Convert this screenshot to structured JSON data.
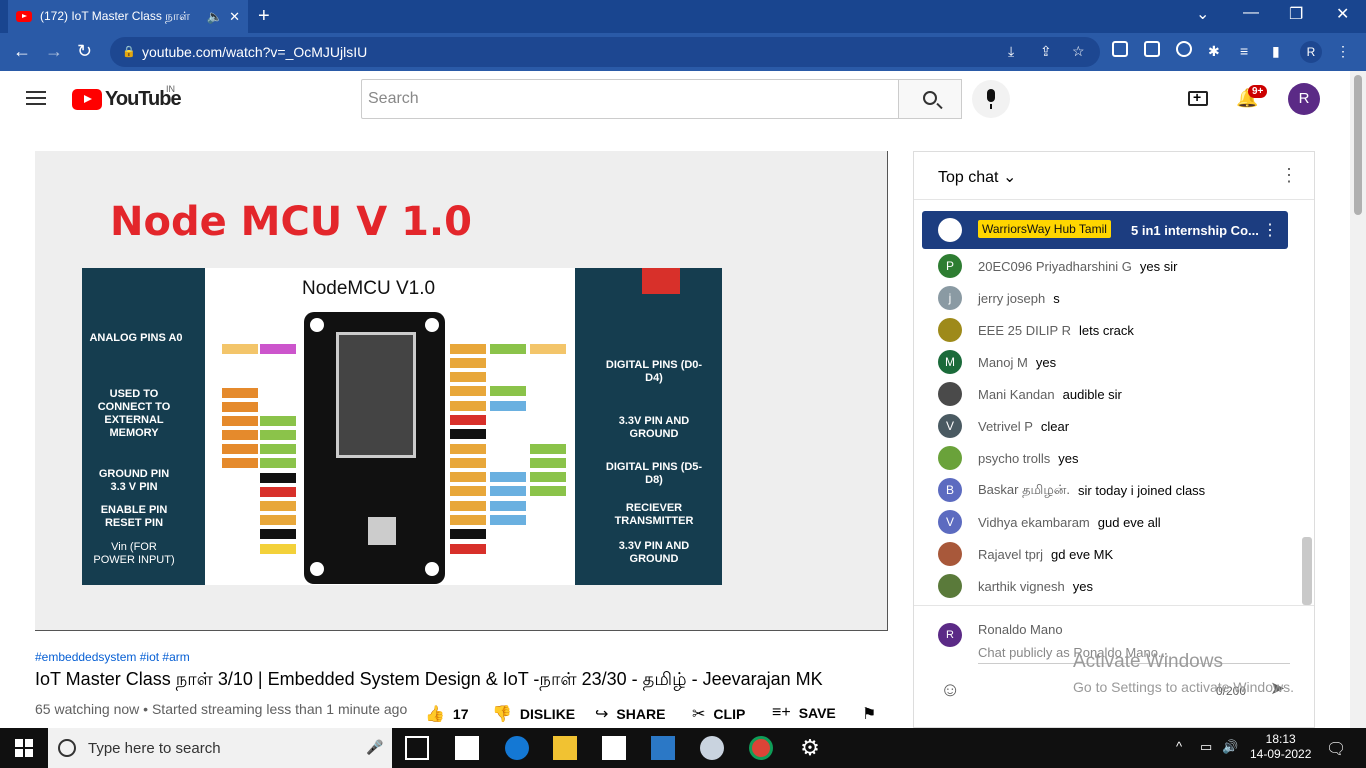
{
  "browser": {
    "tab_title": "(172) IoT Master Class நாள்",
    "new_tab": "+",
    "url": "youtube.com/watch?v=_OcMJUjlsIU",
    "profile_initial": "R"
  },
  "yt": {
    "logo_text": "YouTube",
    "country_code": "IN",
    "search_placeholder": "Search",
    "notif_count": "9+",
    "avatar_initial": "R"
  },
  "video": {
    "slide_title": "Node MCU V 1.0",
    "board_title": "NodeMCU V1.0",
    "left_labels": [
      "ANALOG PINS A0",
      "USED TO CONNECT TO EXTERNAL MEMORY",
      "GROUND PIN 3.3 V PIN",
      "ENABLE PIN RESET PIN",
      "Vin (FOR POWER INPUT)"
    ],
    "right_labels": [
      "DIGITAL PINS (D0-D4)",
      "3.3V PIN AND GROUND",
      "DIGITAL PINS (D5-D8)",
      "RECIEVER TRANSMITTER",
      "3.3V PIN AND GROUND"
    ]
  },
  "watermark": {
    "line1": "Activate Windows",
    "line2": "Go to Settings to activate Windows."
  },
  "info": {
    "tags": "#embeddedsystem #iot #arm",
    "title": "IoT Master Class நாள் 3/10 | Embedded System Design & IoT -நாள் 23/30 - தமிழ் - Jeevarajan MK",
    "meta": "65 watching now • Started streaming less than 1 minute ago",
    "likes": "17",
    "dislike": "DISLIKE",
    "share": "SHARE",
    "clip": "CLIP",
    "save": "SAVE"
  },
  "chat": {
    "mode": "Top chat",
    "pinned_author": "WarriorsWay Hub Tamil",
    "pinned_message": "5 in1 internship Co...",
    "messages": [
      {
        "initial": "P",
        "color": "#2e7d32",
        "author": "20EC096 Priyadharshini G",
        "text": "yes sir"
      },
      {
        "initial": "j",
        "color": "#8a9aa3",
        "author": "jerry joseph",
        "text": "s"
      },
      {
        "initial": "",
        "color": "#9e8a1a",
        "author": "EEE 25 DILIP R",
        "text": "lets crack"
      },
      {
        "initial": "M",
        "color": "#1b6b3a",
        "author": "Manoj M",
        "text": "yes"
      },
      {
        "initial": "",
        "color": "#4a4a4a",
        "author": "Mani Kandan",
        "text": "audible sir"
      },
      {
        "initial": "V",
        "color": "#4a5a62",
        "author": "Vetrivel P",
        "text": "clear"
      },
      {
        "initial": "",
        "color": "#6aa23a",
        "author": "psycho trolls",
        "text": "yes"
      },
      {
        "initial": "B",
        "color": "#5c6bc0",
        "author": "Baskar தமிழன்.",
        "text": "sir today i joined class"
      },
      {
        "initial": "V",
        "color": "#5c6bc0",
        "author": "Vidhya ekambaram",
        "text": "gud eve all"
      },
      {
        "initial": "",
        "color": "#a8583a",
        "author": "Rajavel tprj",
        "text": "gd eve MK"
      },
      {
        "initial": "",
        "color": "#5a7a3a",
        "author": "karthik vignesh",
        "text": "yes"
      }
    ],
    "me_initial": "R",
    "me_name": "Ronaldo Mano",
    "placeholder": "Chat publicly as Ronaldo Mano...",
    "counter": "0/200"
  },
  "taskbar": {
    "search_placeholder": "Type here to search",
    "time": "18:13",
    "date": "14-09-2022"
  }
}
